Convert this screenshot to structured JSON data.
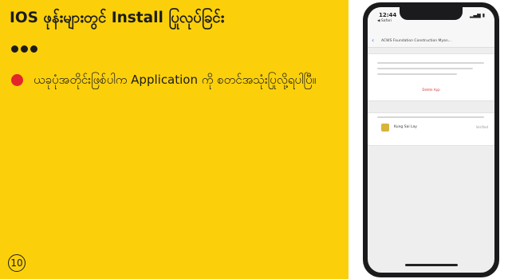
{
  "slide": {
    "title": "IOS ဖုန်းများတွင် Install ပြုလုပ်ခြင်း",
    "body": "ယခုပုံအတိုင်းဖြစ်ပါက Application ကို စတင်အသုံးပြုလို့ရပါပြီ။",
    "page_number": "10"
  },
  "phone": {
    "status_time": "12:44",
    "status_back": "◀ Safari",
    "status_icons": "▂▄▆ ▮",
    "nav_title": "ACWS Foundation Construction Myan...",
    "verify_label": "Delete App",
    "app_name": "Kung Sai Lay",
    "app_status": "Verified"
  },
  "colors": {
    "panel": "#FBD00B",
    "bullet": "#E3262B",
    "text": "#1c1c1c"
  }
}
